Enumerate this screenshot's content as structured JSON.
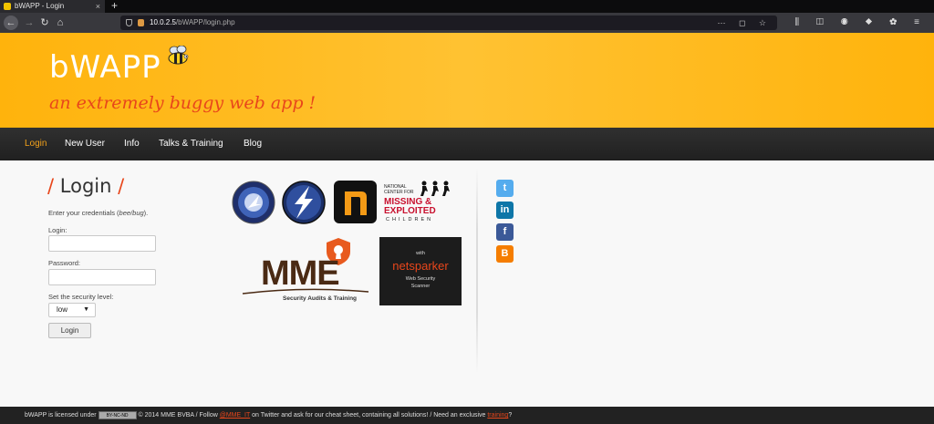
{
  "browser": {
    "tab_title": "bWAPP - Login",
    "tab_close": "×",
    "new_tab": "+",
    "url_host": "10.0.2.5",
    "url_path": "/bWAPP/login.php",
    "url_icons": "⋯ ◻ ☆",
    "tool_icons": "⫼ ◫ ◉ ◆ ✿ ≡"
  },
  "header": {
    "logo": "bWAPP",
    "tagline": "an extremely buggy web app !"
  },
  "menu": {
    "items": [
      "Login",
      "New User",
      "Info",
      "Talks & Training",
      "Blog"
    ]
  },
  "login": {
    "title_slash_left": "/",
    "title": "Login",
    "title_slash_right": "/",
    "hint_prefix": "Enter your credentials (",
    "hint_creds": "bee/bug",
    "hint_suffix": ").",
    "login_label": "Login:",
    "login_value": "",
    "password_label": "Password:",
    "password_value": "",
    "security_label": "Set the security level:",
    "security_value": "low",
    "button": "Login"
  },
  "sponsors": {
    "mme_text": "MME",
    "mme_sub": "Security Audits & Training",
    "netsparker_with": "with",
    "netsparker_name": "netsparker",
    "netsparker_sub1": "Web Security",
    "netsparker_sub2": "Scanner",
    "ncmec_line1": "NATIONAL",
    "ncmec_line2": "CENTER FOR",
    "ncmec_line3": "MISSING &",
    "ncmec_line4": "EXPLOITED",
    "ncmec_line5": "CHILDREN"
  },
  "social": {
    "twitter": "t",
    "linkedin": "in",
    "facebook": "f",
    "blogger": "B"
  },
  "footer": {
    "part1": "bWAPP is licensed under",
    "cc_badge": "BY-NC-ND",
    "part2": "© 2014 MME BVBA / Follow",
    "twitter_handle": "@MME_IT",
    "part3": "on Twitter and ask for our cheat sheet, containing all solutions! / Need an exclusive",
    "training": "training",
    "part4": "?"
  }
}
